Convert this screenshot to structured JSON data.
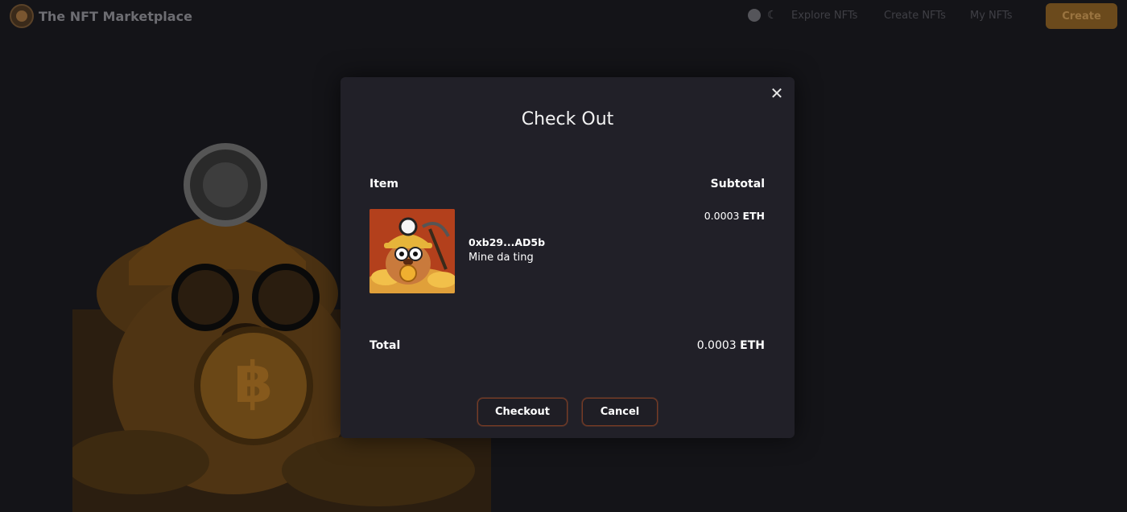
{
  "navbar": {
    "brand": "The NFT Marketplace",
    "links": [
      "Explore NFTs",
      "Create NFTs",
      "My NFTs"
    ],
    "create_label": "Create"
  },
  "modal": {
    "title": "Check Out",
    "close_icon": "close-icon",
    "headers": {
      "item": "Item",
      "subtotal": "Subtotal"
    },
    "item": {
      "id": "0xb29...AD5b",
      "name": "Mine da ting",
      "price_value": "0.0003",
      "price_unit": "ETH"
    },
    "total": {
      "label": "Total",
      "value": "0.0003",
      "unit": "ETH"
    },
    "buttons": {
      "checkout": "Checkout",
      "cancel": "Cancel"
    }
  },
  "colors": {
    "background": "#141418",
    "modal": "#212028",
    "accent_border": "#7a3b24",
    "create_button": "#6b4a1c"
  }
}
